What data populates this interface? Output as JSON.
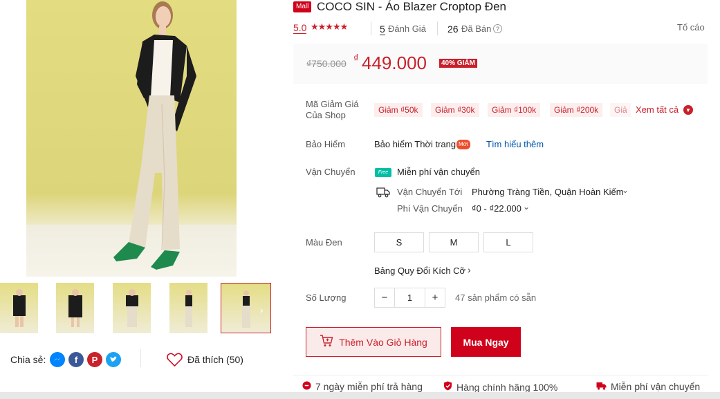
{
  "share": {
    "label": "Chia sẻ:"
  },
  "like": {
    "label": "Đã thích (50)"
  },
  "product": {
    "mall_badge": "Mall",
    "title": "COCO SIN - Áo Blazer Croptop Đen",
    "rating": "5.0",
    "stars": "★★★★★",
    "reviews_count": "5",
    "reviews_label": "Đánh Giá",
    "sold_count": "26",
    "sold_label": "Đã Bán",
    "help_icon": "?",
    "report": "Tố cáo"
  },
  "price": {
    "original": "₫750.000",
    "currency": "₫",
    "current": "449.000",
    "discount": "40% GIẢM"
  },
  "vouchers": {
    "label_line1": "Mã Giảm Giá",
    "label_line2": "Của Shop",
    "items": [
      "Giảm ₫50k",
      "Giảm ₫30k",
      "Giảm ₫100k",
      "Giảm ₫200k",
      "Giả"
    ],
    "see_all": "Xem tất cả"
  },
  "insurance": {
    "label": "Bảo Hiểm",
    "name": "Bảo hiểm Thời trang",
    "badge": "Mới",
    "learn_more": "Tìm hiểu thêm"
  },
  "shipping": {
    "label": "Vận Chuyển",
    "free_badge": "Free",
    "free_text": "Miễn phí vận chuyển",
    "to_label": "Vận Chuyển Tới",
    "to_value": "Phường Tràng Tiền, Quận Hoàn Kiếm",
    "fee_label": "Phí Vận Chuyển",
    "fee_value": "₫0 - ₫22.000"
  },
  "variant": {
    "label": "Màu Đen",
    "sizes": [
      "S",
      "M",
      "L"
    ],
    "size_chart": "Bảng Quy Đổi Kích Cỡ"
  },
  "quantity": {
    "label": "Số Lượng",
    "minus": "−",
    "value": "1",
    "plus": "+",
    "stock": "47 sản phẩm có sẵn"
  },
  "actions": {
    "add_to_cart": "Thêm Vào Giỏ Hàng",
    "buy_now": "Mua Ngay"
  },
  "guarantees": [
    "7 ngày miễn phí trả hàng",
    "Hàng chính hãng 100%",
    "Miễn phí vận chuyển"
  ],
  "colors": {
    "brand": "#d0011b",
    "accent": "#c9202b",
    "link": "#0055aa"
  }
}
